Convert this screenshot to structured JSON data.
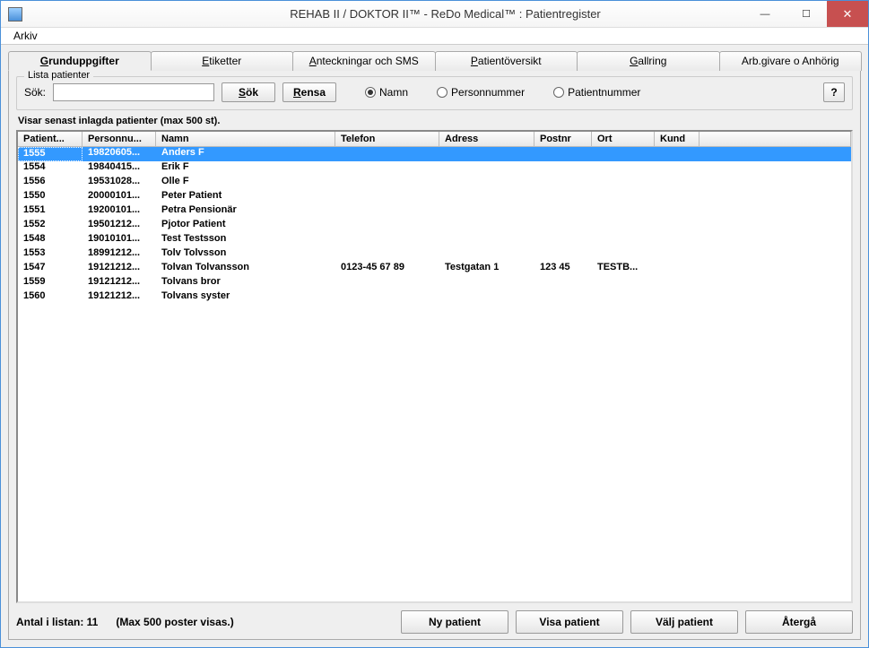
{
  "window": {
    "title": "REHAB II / DOKTOR II™ - ReDo Medical™ : Patientregister"
  },
  "menubar": {
    "arkiv": "Arkiv"
  },
  "tabs": [
    {
      "label": "Grunduppgifter",
      "underl": "G",
      "rest": "runduppgifter"
    },
    {
      "label": "Etiketter",
      "underl": "E",
      "rest": "tiketter"
    },
    {
      "label": "Anteckningar och SMS",
      "underl": "A",
      "rest": "nteckningar och SMS"
    },
    {
      "label": "Patientöversikt",
      "underl": "P",
      "rest": "atientöversikt"
    },
    {
      "label": "Gallring",
      "underl": "G",
      "rest": "allring"
    },
    {
      "label": "Arb.givare o Anhörig",
      "underl": "",
      "rest": "Arb.givare o Anhörig"
    }
  ],
  "group": {
    "title": "Lista patienter",
    "sok_label": "Sök:",
    "sok_underl": "S",
    "sok_rest": "ök",
    "rensa_underl": "R",
    "rensa_rest": "ensa",
    "radio_namn": "Namn",
    "radio_personnummer": "Personnummer",
    "radio_patientnummer": "Patientnummer",
    "help": "?"
  },
  "status_line": "Visar senast inlagda patienter (max 500 st).",
  "columns": [
    "Patient...",
    "Personnu...",
    "Namn",
    "Telefon",
    "Adress",
    "Postnr",
    "Ort",
    "Kund"
  ],
  "rows": [
    {
      "patient": "1555",
      "person": "19820605...",
      "namn": "Anders F",
      "tel": "",
      "adr": "",
      "postnr": "",
      "ort": "",
      "kund": ""
    },
    {
      "patient": "1554",
      "person": "19840415...",
      "namn": "Erik F",
      "tel": "",
      "adr": "",
      "postnr": "",
      "ort": "",
      "kund": ""
    },
    {
      "patient": "1556",
      "person": "19531028...",
      "namn": "Olle F",
      "tel": "",
      "adr": "",
      "postnr": "",
      "ort": "",
      "kund": ""
    },
    {
      "patient": "1550",
      "person": "20000101...",
      "namn": "Peter Patient",
      "tel": "",
      "adr": "",
      "postnr": "",
      "ort": "",
      "kund": ""
    },
    {
      "patient": "1551",
      "person": "19200101...",
      "namn": "Petra Pensionär",
      "tel": "",
      "adr": "",
      "postnr": "",
      "ort": "",
      "kund": ""
    },
    {
      "patient": "1552",
      "person": "19501212...",
      "namn": "Pjotor Patient",
      "tel": "",
      "adr": "",
      "postnr": "",
      "ort": "",
      "kund": ""
    },
    {
      "patient": "1548",
      "person": "19010101...",
      "namn": "Test Testsson",
      "tel": "",
      "adr": "",
      "postnr": "",
      "ort": "",
      "kund": ""
    },
    {
      "patient": "1553",
      "person": "18991212...",
      "namn": "Tolv Tolvsson",
      "tel": "",
      "adr": "",
      "postnr": "",
      "ort": "",
      "kund": ""
    },
    {
      "patient": "1547",
      "person": "19121212...",
      "namn": "Tolvan Tolvansson",
      "tel": "0123-45 67 89",
      "adr": "Testgatan 1",
      "postnr": "123 45",
      "ort": "TESTB...",
      "kund": ""
    },
    {
      "patient": "1559",
      "person": "19121212...",
      "namn": "Tolvans bror",
      "tel": "",
      "adr": "",
      "postnr": "",
      "ort": "",
      "kund": ""
    },
    {
      "patient": "1560",
      "person": "19121212...",
      "namn": "Tolvans syster",
      "tel": "",
      "adr": "",
      "postnr": "",
      "ort": "",
      "kund": ""
    }
  ],
  "footer": {
    "count_label": "Antal i listan: 11",
    "max_label": "(Max 500 poster visas.)",
    "ny": "Ny patient",
    "visa": "Visa patient",
    "valj": "Välj patient",
    "aterga": "Återgå"
  }
}
